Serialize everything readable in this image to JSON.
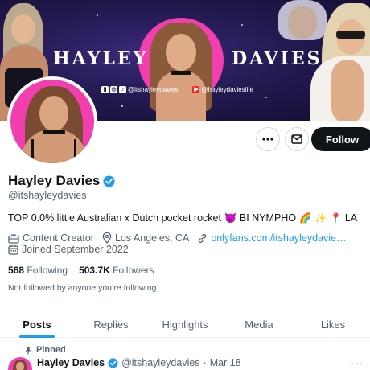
{
  "banner": {
    "title_left": "HAYLEY",
    "title_right": "DAVIES",
    "social_handle_1": "@itshayleydavies",
    "social_handle_2": "@hayleydavieslife",
    "social_icons": [
      "twitch-icon",
      "instagram-icon",
      "tiktok-icon",
      "youtube-icon"
    ]
  },
  "actions": {
    "follow_label": "Follow"
  },
  "profile": {
    "name": "Hayley Davies",
    "handle": "@itshayleydavies",
    "bio": "TOP 0.0% little Australian x Dutch pocket rocket",
    "bio_tail_1": "BI NYMPHO",
    "bio_tail_2": "LA",
    "emojis": [
      "😈",
      "🌈",
      "✨",
      "📍"
    ],
    "category": "Content Creator",
    "location": "Los Angeles, CA",
    "link": "onlyfans.com/itshayleydavie…",
    "joined": "Joined September 2022",
    "following_count": "568",
    "following_label": "Following",
    "followers_count": "503.7K",
    "followers_label": "Followers",
    "not_followed": "Not followed by anyone you’re following"
  },
  "tabs": [
    "Posts",
    "Replies",
    "Highlights",
    "Media",
    "Likes"
  ],
  "active_tab": "Posts",
  "pinned_post": {
    "pinned_label": "Pinned",
    "author_name": "Hayley Davies",
    "author_handle": "@itshayleydavies",
    "separator": "·",
    "date": "Mar 18",
    "more": "···"
  },
  "colors": {
    "accent": "#1d9bf0",
    "text": "#0f1419",
    "muted": "#536471",
    "banner_pink": "#f23fb0",
    "banner_bg": "#231a52"
  }
}
